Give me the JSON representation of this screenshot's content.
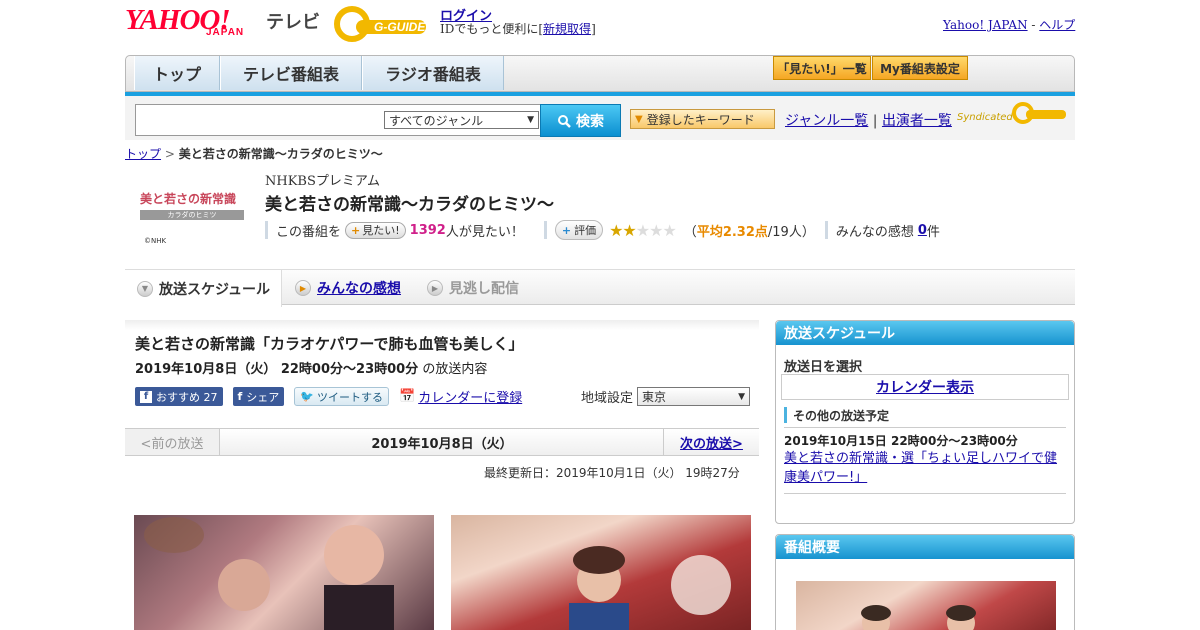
{
  "header": {
    "yahoo_logo": "YAHOO!",
    "yahoo_sub": "JAPAN",
    "tv_label": "テレビ",
    "gguide_logo": "G-GUIDE",
    "login": "ログイン",
    "login_prefix": "IDでもっと便利に[",
    "register": "新規取得",
    "login_suffix": "]",
    "yahoo_japan": "Yahoo! JAPAN",
    "dash": "-",
    "help": "ヘルプ"
  },
  "nav": {
    "tabs": [
      "トップ",
      "テレビ番組表",
      "ラジオ番組表"
    ],
    "mitai_list": "「見たい!」一覧",
    "my_schedule": "My番組表設定"
  },
  "search": {
    "genre_selected": "すべてのジャンル",
    "button": "検索",
    "keywords": "登録したキーワード",
    "genre_list": "ジャンル一覧",
    "divider": "|",
    "performer_list": "出演者一覧",
    "syndicated": "Syndicated"
  },
  "breadcrumb": {
    "top": "トップ",
    "sep": ">",
    "current": "美と若さの新常識～カラダのヒミツ～"
  },
  "program": {
    "logo_title": "美と若さの新常識",
    "logo_sub": "カラダのヒミツ",
    "copyright": "©NHK",
    "channel": "NHKBSプレミアム",
    "title": "美と若さの新常識～カラダのヒミツ～",
    "mitai_prefix": "この番組を",
    "mitai_button": "見たい!",
    "mitai_count": "1392",
    "mitai_suffix": "人が見たい！",
    "eval_button": "評価",
    "rating_stars": 2,
    "avg_prefix": "（",
    "avg_label": "平均2.32点",
    "avg_suffix": "/19人）",
    "impressions_label": "みんなの感想",
    "impressions_count": "0",
    "impressions_suffix": "件"
  },
  "tabs": {
    "schedule": "放送スケジュール",
    "impressions": "みんなの感想",
    "catchup": "見逃し配信"
  },
  "episode": {
    "title": "美と若さの新常識「カラオケパワーで肺も血管も美しく」",
    "datetime": "2019年10月8日（火） 22時00分～23時00分",
    "suffix": "の放送内容",
    "fb_recommend": "おすすめ 27",
    "fb_share": "シェア",
    "tweet": "ツイートする",
    "calendar": "カレンダーに登録",
    "region_label": "地域設定",
    "region_value": "東京",
    "prev": "<前の放送",
    "current_date": "2019年10月8日（火）",
    "next": "次の放送>",
    "updated": "最終更新日：2019年10月1日（火） 19時27分"
  },
  "sidebar": {
    "schedule_head": "放送スケジュール",
    "select_date": "放送日を選択",
    "calendar_show": "カレンダー表示",
    "other_head": "その他の放送予定",
    "other_date": "2019年10月15日 22時00分～23時00分",
    "other_title": "美と若さの新常識・選「ちょい足しハワイで健康美パワー!」",
    "summary_head": "番組概要"
  },
  "colors": {
    "yahoo_red": "#ff0033",
    "accent_blue": "#1aa0e0",
    "pink_count": "#d0208a",
    "orange_avg": "#e88a00",
    "star_gold": "#d8a600"
  }
}
